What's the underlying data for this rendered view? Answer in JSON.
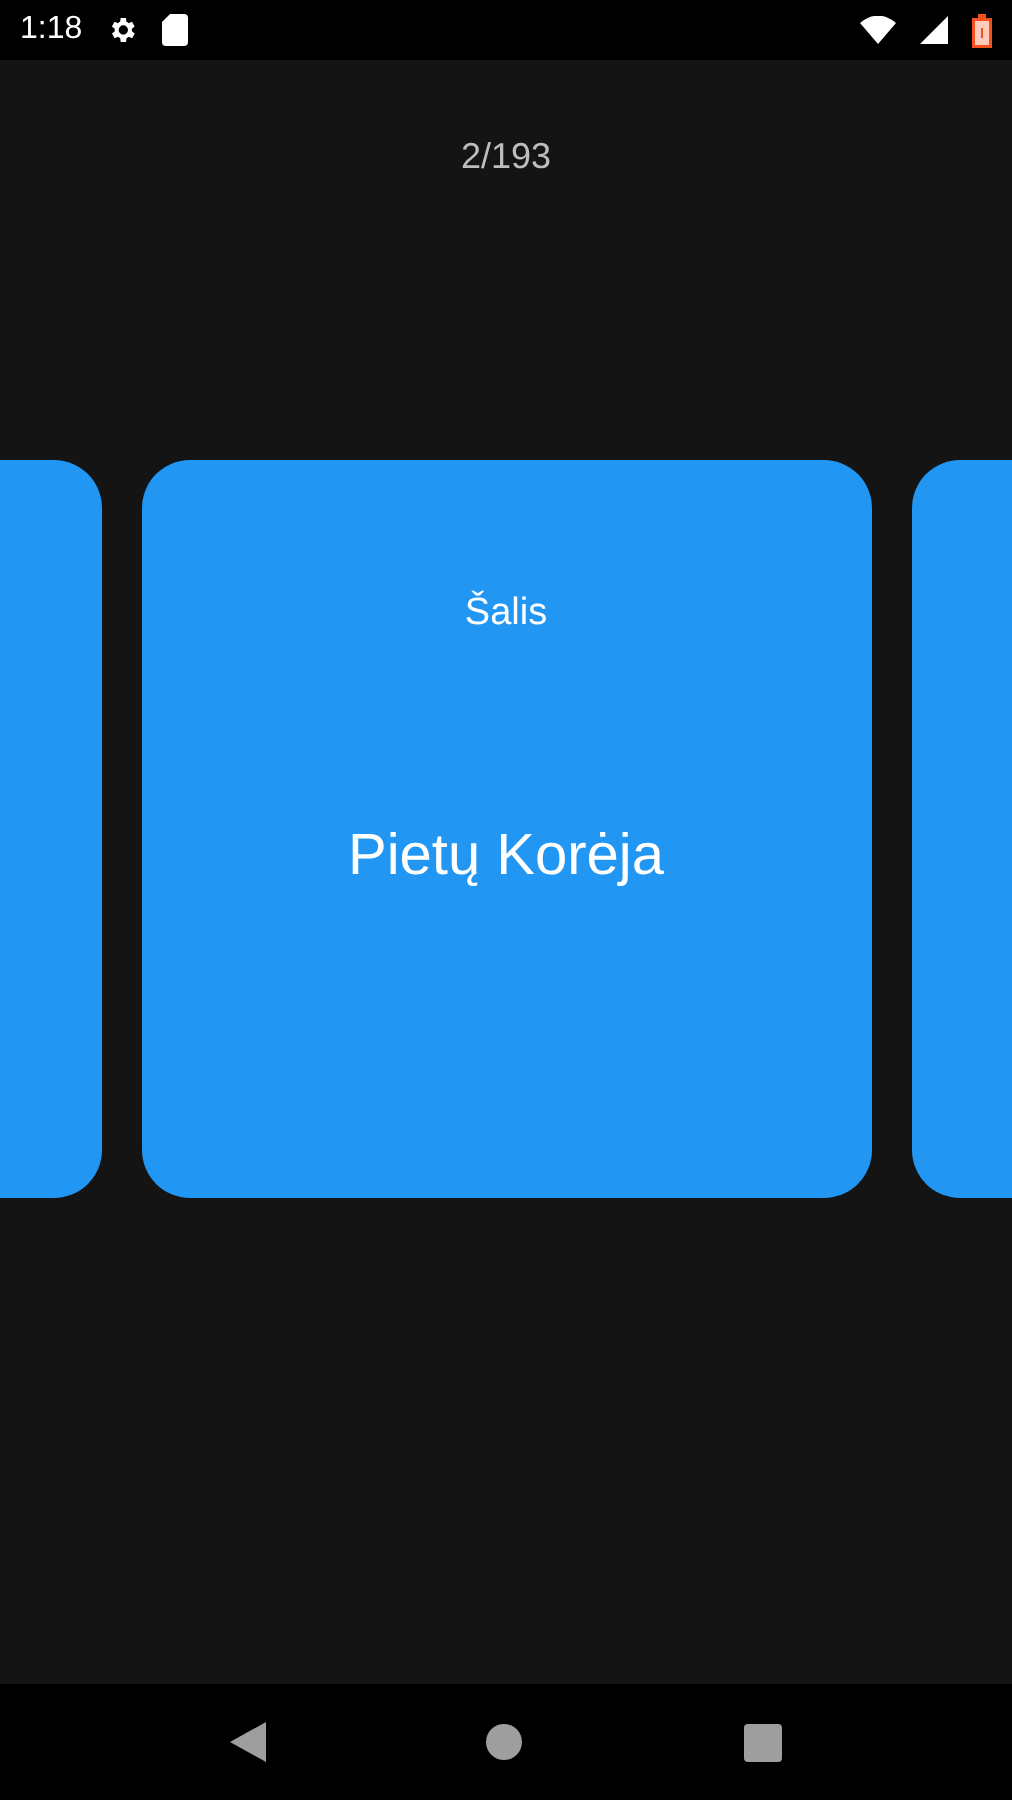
{
  "status_bar": {
    "time": "1:18"
  },
  "counter": "2/193",
  "card": {
    "label": "Šalis",
    "text": "Pietų Korėja"
  }
}
